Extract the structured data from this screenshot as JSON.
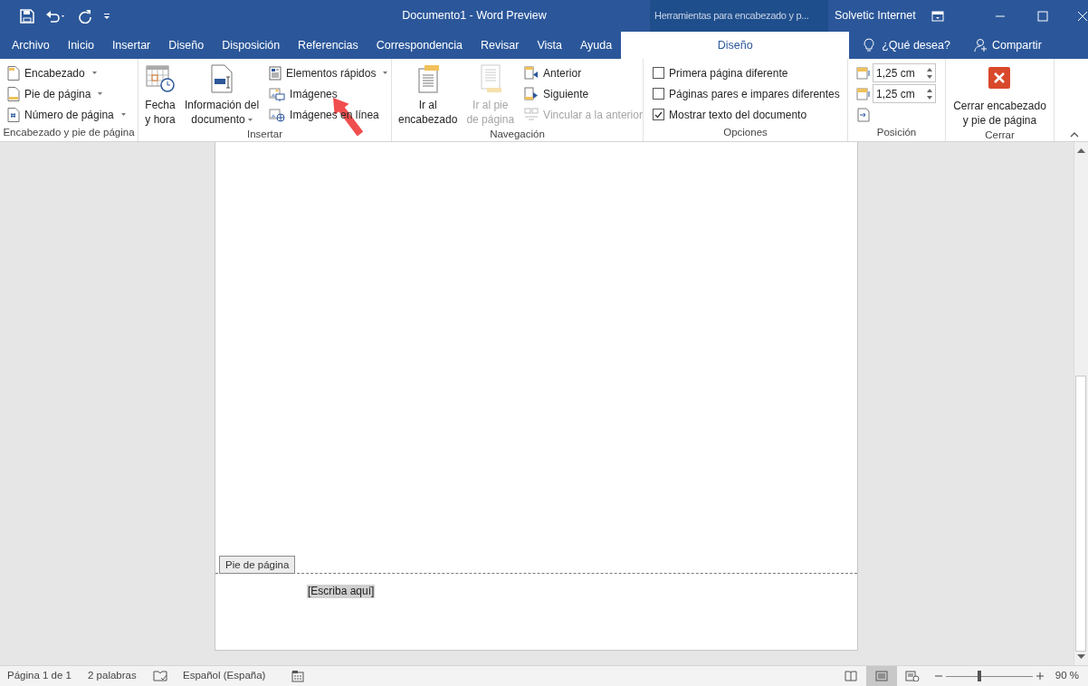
{
  "window": {
    "title": "Documento1  -  Word Preview",
    "context_label": "Herramientas para encabezado y p...",
    "user": "Solvetic Internet"
  },
  "tabs": [
    {
      "label": "Archivo",
      "selected": false
    },
    {
      "label": "Inicio",
      "selected": false
    },
    {
      "label": "Insertar",
      "selected": false
    },
    {
      "label": "Diseño",
      "selected": false
    },
    {
      "label": "Disposición",
      "selected": false
    },
    {
      "label": "Referencias",
      "selected": false
    },
    {
      "label": "Correspondencia",
      "selected": false
    },
    {
      "label": "Revisar",
      "selected": false
    },
    {
      "label": "Vista",
      "selected": false
    },
    {
      "label": "Ayuda",
      "selected": false
    },
    {
      "label": "Diseño",
      "selected": true
    }
  ],
  "tell_me": "¿Qué desea?",
  "share": "Compartir",
  "ribbon": {
    "groups": [
      {
        "label": "Encabezado y pie de página",
        "columns": [
          [
            {
              "kind": "small",
              "label": "Encabezado",
              "dropdown": true,
              "disabled": false
            },
            {
              "kind": "small",
              "label": "Pie de página",
              "dropdown": true,
              "disabled": false
            },
            {
              "kind": "small",
              "label": "Número de página",
              "dropdown": true,
              "disabled": false
            }
          ]
        ]
      },
      {
        "label": "Insertar",
        "columns": [
          [
            {
              "kind": "large",
              "lines": [
                "Fecha",
                "y hora"
              ],
              "dropdown": false,
              "disabled": false
            }
          ],
          [
            {
              "kind": "large",
              "lines": [
                "Información del",
                "documento"
              ],
              "dropdown": true,
              "disabled": false
            }
          ],
          [
            {
              "kind": "small",
              "label": "Elementos rápidos",
              "dropdown": true,
              "disabled": false
            },
            {
              "kind": "small",
              "label": "Imágenes",
              "dropdown": false,
              "disabled": false
            },
            {
              "kind": "small",
              "label": "Imágenes en línea",
              "dropdown": false,
              "disabled": false
            }
          ]
        ]
      },
      {
        "label": "Navegación",
        "columns": [
          [
            {
              "kind": "large",
              "lines": [
                "Ir al",
                "encabezado"
              ],
              "dropdown": false,
              "disabled": false
            }
          ],
          [
            {
              "kind": "large",
              "lines": [
                "Ir al pie",
                "de página"
              ],
              "dropdown": false,
              "disabled": true
            }
          ],
          [
            {
              "kind": "small",
              "label": "Anterior",
              "dropdown": false,
              "disabled": false
            },
            {
              "kind": "small",
              "label": "Siguiente",
              "dropdown": false,
              "disabled": false
            },
            {
              "kind": "small",
              "label": "Vincular a la anterior",
              "dropdown": false,
              "disabled": true
            }
          ]
        ]
      },
      {
        "label": "Opciones",
        "columns": [
          [
            {
              "kind": "checkbox",
              "label": "Primera página diferente",
              "checked": false
            },
            {
              "kind": "checkbox",
              "label": "Páginas pares e impares diferentes",
              "checked": false
            },
            {
              "kind": "checkbox",
              "label": "Mostrar texto del documento",
              "checked": true
            }
          ]
        ]
      },
      {
        "label": "Posición",
        "columns": [
          [
            {
              "kind": "spinner",
              "value": "1,25 cm"
            },
            {
              "kind": "spinner",
              "value": "1,25 cm"
            },
            {
              "kind": "icon"
            }
          ]
        ]
      },
      {
        "label": "Cerrar",
        "columns": [
          [
            {
              "kind": "large",
              "lines": [
                "Cerrar encabezado",
                "y pie de página"
              ],
              "dropdown": false,
              "disabled": false
            }
          ]
        ]
      }
    ]
  },
  "document": {
    "footer_tab": "Pie de página",
    "footer_placeholder": "[Escriba aquí]"
  },
  "status_bar": {
    "page": "Página 1 de 1",
    "words": "2 palabras",
    "language": "Español (España)",
    "views": [
      {
        "selected": false
      },
      {
        "selected": true
      },
      {
        "selected": false
      }
    ],
    "zoom_slider": {
      "level": 0.38
    },
    "zoom": "90 %"
  }
}
